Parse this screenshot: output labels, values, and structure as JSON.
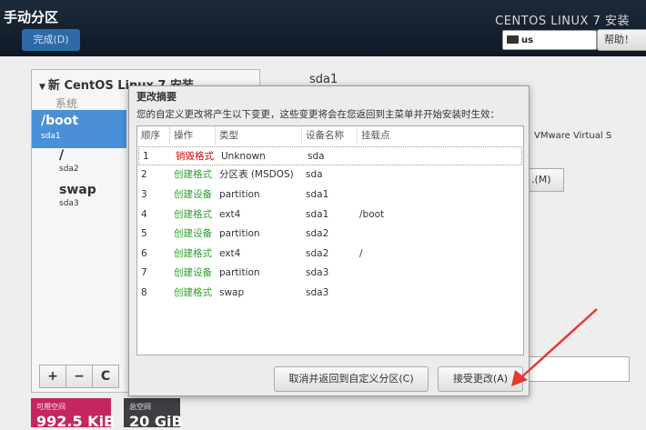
{
  "header": {
    "title": "手动分区",
    "done_label": "完成(D)",
    "os_title": "CENTOS LINUX 7 安装",
    "keyboard_layout": "us",
    "help_label": "帮助！"
  },
  "left_panel": {
    "install_title": "新 CentOS Linux 7 安装",
    "section_label": "系统",
    "mount_points": [
      {
        "name": "/boot",
        "device": "sda1",
        "selected": true
      },
      {
        "name": "/",
        "device": "sda2",
        "selected": false
      },
      {
        "name": "swap",
        "device": "sda3",
        "selected": false
      }
    ],
    "toolbar": {
      "add": "+",
      "remove": "−",
      "refresh": "C"
    }
  },
  "space": {
    "available_label": "可用空间",
    "available_value": "992.5 KiB",
    "total_label": "总空间",
    "total_value": "20 GiB"
  },
  "right_panel": {
    "device": "sda1",
    "model": "VMware Virtual S",
    "button_partial": ".(M)"
  },
  "dialog": {
    "title": "更改摘要",
    "description": "您的自定义更改将产生以下变更，这些变更将会在您返回到主菜单并开始安装时生效：",
    "columns": [
      "顺序",
      "操作",
      "类型",
      "设备名称",
      "挂载点"
    ],
    "rows": [
      {
        "order": "1",
        "action": "销毁格式",
        "type": "Unknown",
        "device": "sda",
        "mount": ""
      },
      {
        "order": "2",
        "action": "创建格式",
        "type": "分区表 (MSDOS)",
        "device": "sda",
        "mount": ""
      },
      {
        "order": "3",
        "action": "创建设备",
        "type": "partition",
        "device": "sda1",
        "mount": ""
      },
      {
        "order": "4",
        "action": "创建格式",
        "type": "ext4",
        "device": "sda1",
        "mount": "/boot"
      },
      {
        "order": "5",
        "action": "创建设备",
        "type": "partition",
        "device": "sda2",
        "mount": ""
      },
      {
        "order": "6",
        "action": "创建格式",
        "type": "ext4",
        "device": "sda2",
        "mount": "/"
      },
      {
        "order": "7",
        "action": "创建设备",
        "type": "partition",
        "device": "sda3",
        "mount": ""
      },
      {
        "order": "8",
        "action": "创建格式",
        "type": "swap",
        "device": "sda3",
        "mount": ""
      }
    ],
    "cancel_label": "取消并返回到自定义分区(C)",
    "accept_label": "接受更改(A)"
  },
  "colors": {
    "header_bg": "#16212e",
    "selected_bg": "#4a90d9",
    "destroy_action": "#d60000",
    "create_action": "#2ca02c",
    "available_bg": "#c4265f",
    "total_bg": "#3d3f42",
    "annotation_arrow": "#e8382e"
  }
}
